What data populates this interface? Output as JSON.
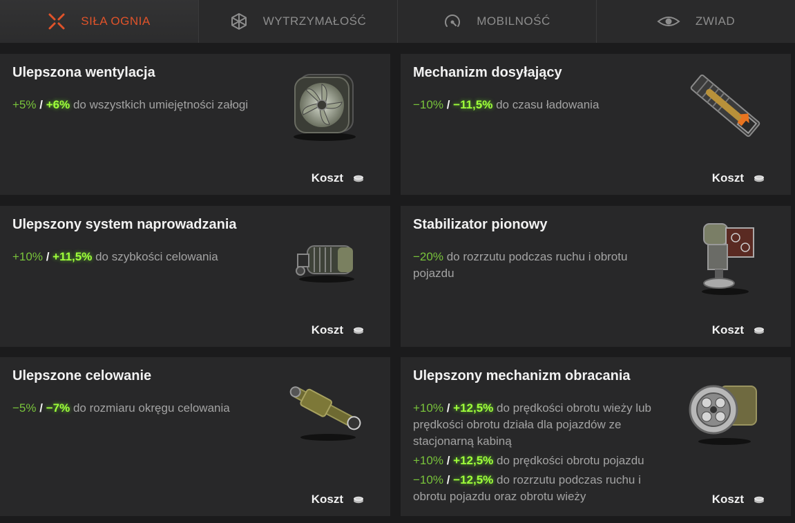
{
  "tabs": [
    {
      "label": "SIŁA OGNIA",
      "icon": "crossfire-icon",
      "active": true
    },
    {
      "label": "WYTRZYMAŁOŚĆ",
      "icon": "armor-icon",
      "active": false
    },
    {
      "label": "MOBILNOŚĆ",
      "icon": "speedometer-icon",
      "active": false
    },
    {
      "label": "ZWIAD",
      "icon": "eye-icon",
      "active": false
    }
  ],
  "cards": [
    {
      "title": "Ulepszona wentylacja",
      "icon": "ventilation-fan-icon",
      "effects": [
        {
          "v1": "+5%",
          "sep": "/",
          "v2": "+6%",
          "text": "do wszystkich umiejętności załogi"
        }
      ],
      "cost_label": "Koszt"
    },
    {
      "title": "Mechanizm dosyłający",
      "icon": "rammer-icon",
      "effects": [
        {
          "v1": "−10%",
          "sep": "/",
          "v2": "−11,5%",
          "text": "do czasu ładowania"
        }
      ],
      "cost_label": "Koszt"
    },
    {
      "title": "Ulepszony system naprowadzania",
      "icon": "gun-laying-drive-icon",
      "effects": [
        {
          "v1": "+10%",
          "sep": "/",
          "v2": "+11,5%",
          "text": "do szybkości celowania"
        }
      ],
      "cost_label": "Koszt"
    },
    {
      "title": "Stabilizator pionowy",
      "icon": "vertical-stabilizer-icon",
      "effects": [
        {
          "v1": "−20%",
          "sep": "",
          "v2": "",
          "text": "do rozrzutu podczas ruchu i obrotu pojazdu"
        }
      ],
      "cost_label": "Koszt"
    },
    {
      "title": "Ulepszone celowanie",
      "icon": "aiming-rod-icon",
      "effects": [
        {
          "v1": "−5%",
          "sep": "/",
          "v2": "−7%",
          "text": "do rozmiaru okręgu celowania"
        }
      ],
      "cost_label": "Koszt"
    },
    {
      "title": "Ulepszony mechanizm obracania",
      "icon": "turret-rotation-mechanism-icon",
      "effects": [
        {
          "v1": "+10%",
          "sep": "/",
          "v2": "+12,5%",
          "text": "do prędkości obrotu wieży lub prędkości obrotu działa dla pojazdów ze stacjonarną kabiną"
        },
        {
          "v1": "+10%",
          "sep": "/",
          "v2": "+12,5%",
          "text": "do prędkości obrotu pojazdu"
        },
        {
          "v1": "−10%",
          "sep": "/",
          "v2": "−12,5%",
          "text": "do rozrzutu podczas ruchu i obrotu pojazdu oraz obrotu wieży"
        }
      ],
      "cost_label": "Koszt"
    }
  ],
  "colors": {
    "accent": "#e0532a",
    "value_base": "#79c43b",
    "value_bonus": "#9fff3a",
    "card_bg": "#282829",
    "page_bg": "#1b1b1c"
  }
}
